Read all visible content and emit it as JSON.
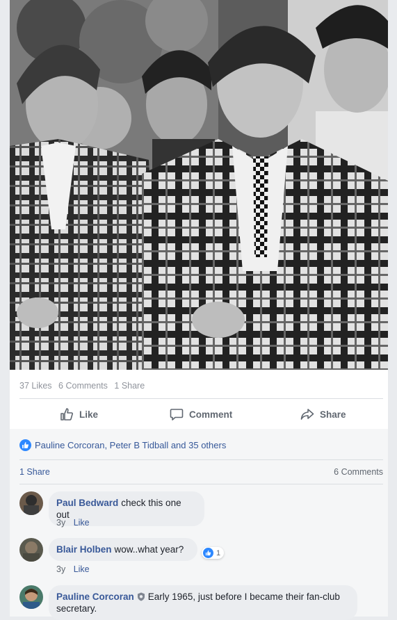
{
  "post": {
    "likes": "37 Likes",
    "comments": "6 Comments",
    "shares": "1 Share"
  },
  "actions": {
    "like": "Like",
    "comment": "Comment",
    "share": "Share"
  },
  "reactions_summary": "Pauline Corcoran, Peter B Tidball and 35 others",
  "share_row": {
    "left": "1 Share",
    "right": "6 Comments"
  },
  "comments": [
    {
      "name": "Paul Bedward",
      "text": "check this one out",
      "time": "3y",
      "like": "Like"
    },
    {
      "name": "Blair Holben",
      "text": "wow..what year?",
      "time": "3y",
      "like": "Like",
      "reaction_count": "1"
    },
    {
      "name": "Pauline Corcoran",
      "text": "Early 1965, just before I became their fan-club",
      "text2": "secretary."
    }
  ],
  "colors": {
    "link": "#385898",
    "muted": "#606770",
    "like_blue": "#2d88ff"
  }
}
